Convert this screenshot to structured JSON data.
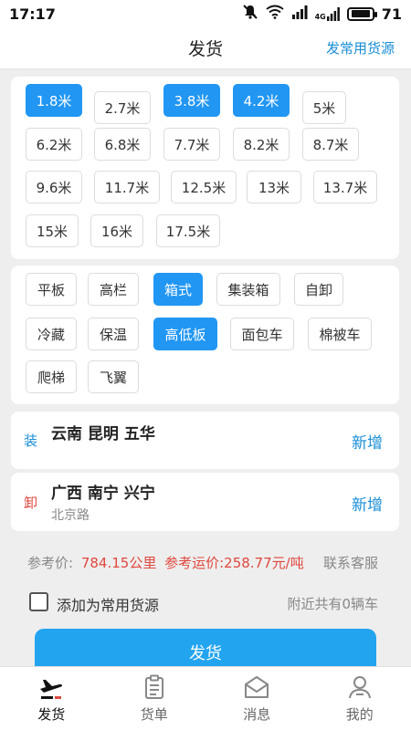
{
  "status_bar": {
    "time": "17:17",
    "battery": "71",
    "signal": "4G"
  },
  "nav": {
    "title": "发货",
    "right_action": "发常用货源"
  },
  "lengths": [
    {
      "label": "1.8米",
      "selected": true
    },
    {
      "label": "2.7米",
      "selected": false
    },
    {
      "label": "3.8米",
      "selected": true
    },
    {
      "label": "4.2米",
      "selected": true
    },
    {
      "label": "5米",
      "selected": false
    },
    {
      "label": "6.2米",
      "selected": false
    },
    {
      "label": "6.8米",
      "selected": false
    },
    {
      "label": "7.7米",
      "selected": false
    },
    {
      "label": "8.2米",
      "selected": false
    },
    {
      "label": "8.7米",
      "selected": false
    },
    {
      "label": "9.6米",
      "selected": false
    },
    {
      "label": "11.7米",
      "selected": false
    },
    {
      "label": "12.5米",
      "selected": false
    },
    {
      "label": "13米",
      "selected": false
    },
    {
      "label": "13.7米",
      "selected": false
    },
    {
      "label": "15米",
      "selected": false
    },
    {
      "label": "16米",
      "selected": false
    },
    {
      "label": "17.5米",
      "selected": false
    }
  ],
  "types": [
    {
      "label": "平板",
      "selected": false
    },
    {
      "label": "高栏",
      "selected": false
    },
    {
      "label": "箱式",
      "selected": true
    },
    {
      "label": "集装箱",
      "selected": false
    },
    {
      "label": "自卸",
      "selected": false
    },
    {
      "label": "冷藏",
      "selected": false
    },
    {
      "label": "保温",
      "selected": false
    },
    {
      "label": "高低板",
      "selected": true
    },
    {
      "label": "面包车",
      "selected": false
    },
    {
      "label": "棉被车",
      "selected": false
    },
    {
      "label": "爬梯",
      "selected": false
    },
    {
      "label": "飞翼",
      "selected": false
    }
  ],
  "load": {
    "tag": "装",
    "address": "云南  昆明  五华",
    "action": "新增"
  },
  "unload": {
    "tag": "卸",
    "address": "广西  南宁  兴宁",
    "detail": "北京路",
    "action": "新增"
  },
  "price": {
    "label": "参考价:",
    "distance": "784.15公里",
    "fee": "参考运价:258.77元/吨",
    "service": "联系客服"
  },
  "options": {
    "checkbox_label": "添加为常用货源",
    "checked": false,
    "nearby": "附近共有0辆车"
  },
  "submit_label": "发货",
  "tabs": [
    {
      "label": "发货",
      "icon": "plane-icon",
      "active": true
    },
    {
      "label": "货单",
      "icon": "document-icon",
      "active": false
    },
    {
      "label": "消息",
      "icon": "envelope-icon",
      "active": false
    },
    {
      "label": "我的",
      "icon": "person-icon",
      "active": false
    }
  ],
  "colors": {
    "accent": "#2196f3",
    "button": "#23a4ef",
    "link": "#1a8ed6",
    "price": "#e0483e",
    "load_tag": "#1a8ed6",
    "unload_tag": "#e0483e"
  }
}
